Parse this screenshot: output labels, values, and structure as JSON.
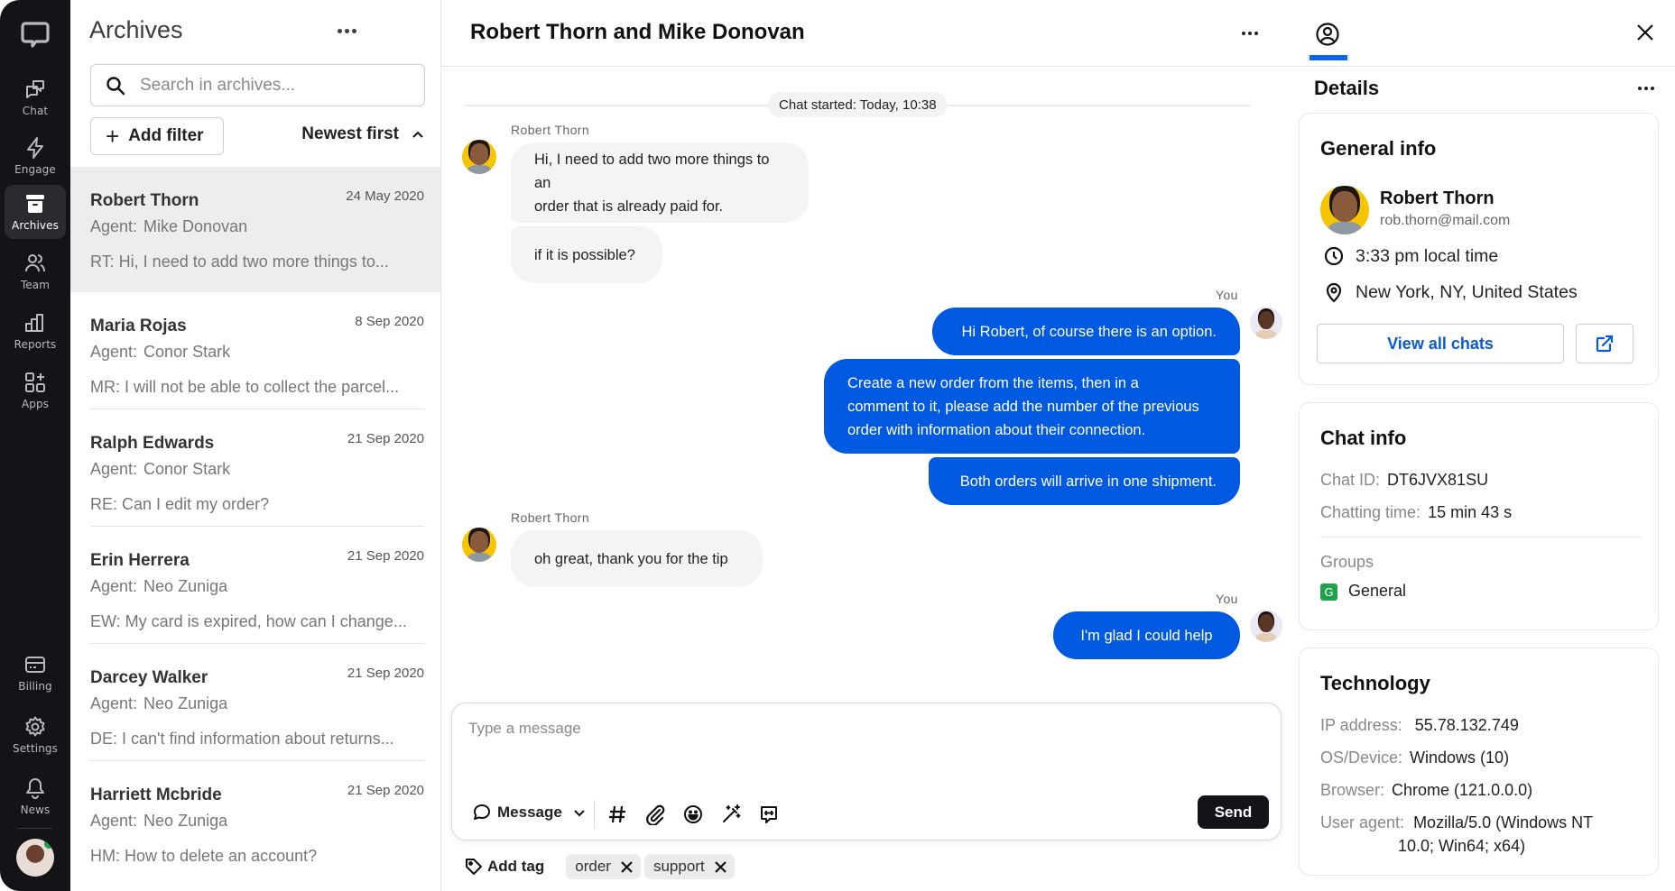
{
  "sidebar": {
    "logo": "chat-bubble-logo",
    "items": [
      {
        "label": "Chat",
        "icon": "chat-icon"
      },
      {
        "label": "Engage",
        "icon": "lightning-icon"
      },
      {
        "label": "Archives",
        "icon": "archive-box-icon",
        "active": true
      },
      {
        "label": "Team",
        "icon": "team-icon"
      },
      {
        "label": "Reports",
        "icon": "bar-chart-icon"
      },
      {
        "label": "Apps",
        "icon": "apps-icon"
      }
    ],
    "bottom_items": [
      {
        "label": "Billing",
        "icon": "credit-card-icon"
      },
      {
        "label": "Settings",
        "icon": "gear-icon"
      },
      {
        "label": "News",
        "icon": "bell-icon"
      }
    ],
    "user_status_color": "#20a14b"
  },
  "archives": {
    "title": "Archives",
    "search_placeholder": "Search in archives...",
    "add_filter_label": "Add filter",
    "sort_label": "Newest first",
    "agent_label": "Agent:",
    "items": [
      {
        "name": "Robert Thorn",
        "date": "24 May 2020",
        "agent": "Mike Donovan",
        "preview": "RT: Hi, I need to add two more things to...",
        "active": true
      },
      {
        "name": "Maria Rojas",
        "date": "8 Sep 2020",
        "agent": "Conor Stark",
        "preview": "MR: I will not be able to collect the parcel..."
      },
      {
        "name": "Ralph Edwards",
        "date": "21 Sep 2020",
        "agent": "Conor Stark",
        "preview": "RE: Can I edit my order?"
      },
      {
        "name": "Erin Herrera",
        "date": "21 Sep 2020",
        "agent": "Neo Zuniga",
        "preview": "EW: My card is expired, how can I change..."
      },
      {
        "name": "Darcey Walker",
        "date": "21 Sep 2020",
        "agent": "Neo Zuniga",
        "preview": "DE: I can't find information about returns..."
      },
      {
        "name": "Harriett Mcbride",
        "date": "21 Sep 2020",
        "agent": "Neo Zuniga",
        "preview": "HM: How to delete an account?"
      }
    ]
  },
  "chat": {
    "title": "Robert Thorn and Mike Donovan",
    "started": "Chat started: Today, 10:38",
    "customer_name": "Robert Thorn",
    "you_label": "You",
    "messages": [
      {
        "from": "customer",
        "text_lines": [
          "Hi, I need to add two more things to an",
          "order that is already paid for."
        ]
      },
      {
        "from": "customer",
        "text_lines": [
          "if it is possible?"
        ]
      },
      {
        "from": "agent",
        "text_lines": [
          "Hi Robert, of course there is an option."
        ]
      },
      {
        "from": "agent",
        "text_lines": [
          "Create a new order from the items, then in a",
          "comment to it, please add the number of the previous",
          "order with information about their connection."
        ]
      },
      {
        "from": "agent",
        "text_lines": [
          "Both orders will arrive in one shipment."
        ]
      },
      {
        "from": "customer",
        "text_lines": [
          "oh great, thank you for the tip"
        ]
      },
      {
        "from": "agent",
        "text_lines": [
          "I'm glad I could help"
        ]
      }
    ],
    "composer": {
      "placeholder": "Type a message",
      "value": "",
      "mode_label": "Message",
      "send_label": "Send",
      "tools": [
        "hashtag-icon",
        "paperclip-icon",
        "emoji-icon",
        "magic-wand-icon",
        "canned-response-icon"
      ]
    },
    "add_tag_label": "Add tag",
    "tags": [
      "order",
      "support"
    ],
    "agent_bubble_color": "#0059e1"
  },
  "details": {
    "title": "Details",
    "general_info": {
      "title": "General info",
      "name": "Robert Thorn",
      "email": "rob.thorn@mail.com",
      "local_time": "3:33 pm local time",
      "location": "New York, NY, United States",
      "view_all_label": "View all chats"
    },
    "chat_info": {
      "title": "Chat info",
      "chat_id_label": "Chat ID:",
      "chat_id": "DT6JVX81SU",
      "chatting_time_label": "Chatting time:",
      "chatting_time": "15 min 43 s",
      "groups_label": "Groups",
      "group_badge": "G",
      "group_name": "General"
    },
    "technology": {
      "title": "Technology",
      "ip_label": "IP address:",
      "ip": "55.78.132.749",
      "os_label": "OS/Device:",
      "os": "Windows (10)",
      "browser_label": "Browser:",
      "browser": "Chrome (121.0.0.0)",
      "ua_label": "User agent:",
      "ua_line1": "Mozilla/5.0 (Windows NT",
      "ua_line2": "10.0; Win64; x64)"
    },
    "accent_color": "#0a66f0"
  }
}
